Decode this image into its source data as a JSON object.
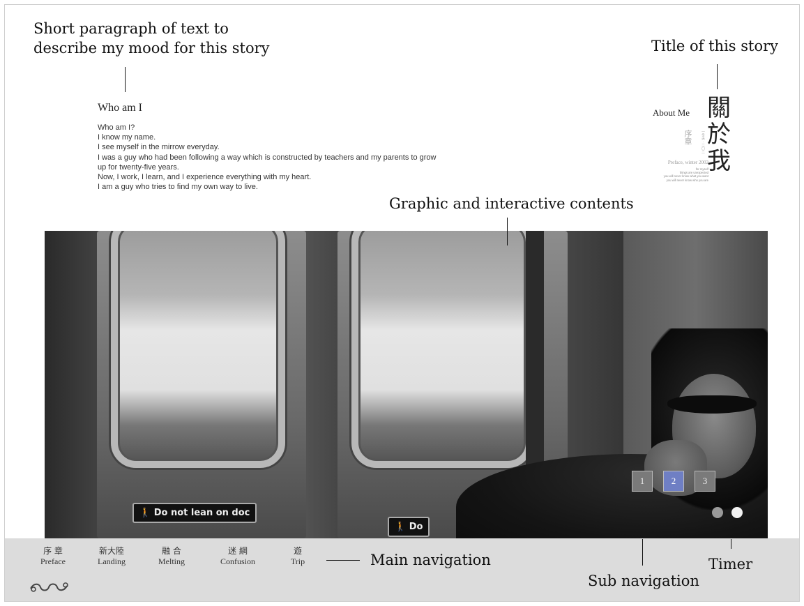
{
  "annotations": {
    "mood": [
      "Short paragraph of text to",
      "describe my mood for this story"
    ],
    "title": "Title of this story",
    "graphic": "Graphic and interactive contents",
    "main_navigation": "Main navigation",
    "sub_navigation": "Sub navigation",
    "timer": "Timer"
  },
  "mood": {
    "heading": "Who am I",
    "lines": [
      "Who am I?",
      "I know my name.",
      "I see myself in the mirrow everyday.",
      "I was a guy who had been following a way which is constructed by teachers and my parents to grow",
      "up for twenty-five years.",
      "Now, I work, I learn, and I experience everything with my heart.",
      "I am a guy who tries to find my own way to live."
    ]
  },
  "story": {
    "about_label": "About Me",
    "title_chars": [
      "關",
      "於",
      "我"
    ],
    "preface_cjk": "序章",
    "preface_sub": "一冬天 · 二〇二",
    "preface_line": "Preface, winter 2002",
    "small_lines": [
      "for myself",
      "things are unexpected",
      "you will never know what you want",
      "you will never know who you are"
    ]
  },
  "photo": {
    "sign_text_1": "Do not lean on doc",
    "sign_text_2": "Do"
  },
  "sub_nav": {
    "buttons": [
      "1",
      "2",
      "3"
    ],
    "active_index": 1,
    "accent_color": "#6f7fc4"
  },
  "timer": {
    "dot_colors": [
      "#9a9a9a",
      "#f2f2f2"
    ]
  },
  "main_nav": {
    "items": [
      {
        "cjk": "序 章",
        "en": "Preface"
      },
      {
        "cjk": "新大陸",
        "en": "Landing"
      },
      {
        "cjk": "融 合",
        "en": "Melting"
      },
      {
        "cjk": "迷 網",
        "en": "Confusion"
      },
      {
        "cjk": "遊",
        "en": "Trip"
      }
    ]
  }
}
